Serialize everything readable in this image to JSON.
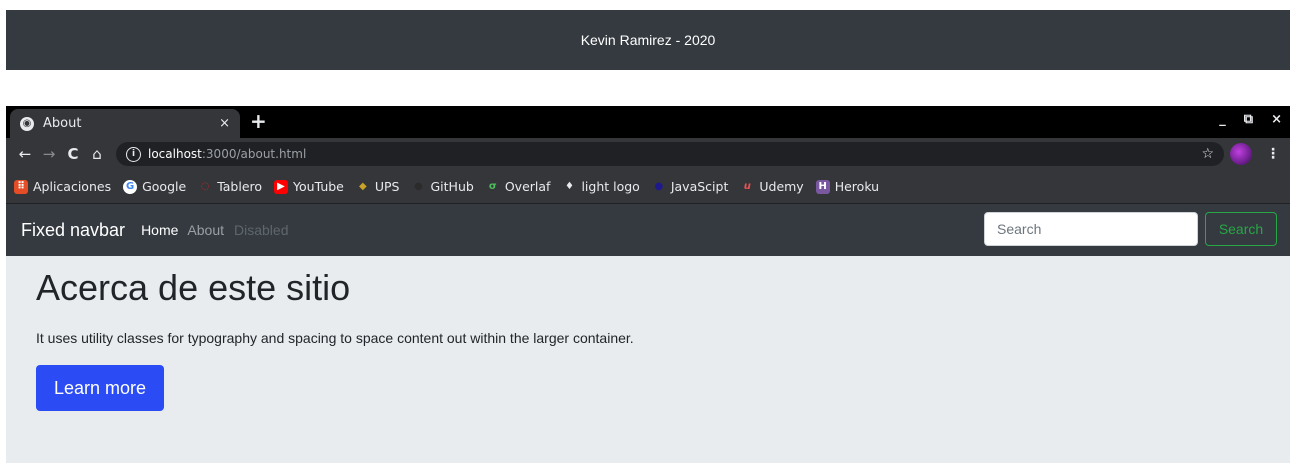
{
  "footer": {
    "text": "Kevin Ramirez - 2020"
  },
  "browser": {
    "tab": {
      "title": "About",
      "close": "×"
    },
    "new_tab": "+",
    "window_controls": [
      "_",
      "⧉",
      "×"
    ],
    "toolbar": {
      "back": "←",
      "forward": "→",
      "reload": "C",
      "home": "⌂",
      "url_host": "localhost",
      "url_path": ":3000/about.html",
      "star": "☆",
      "menu": "⋮"
    },
    "bookmarks": [
      {
        "label": "Aplicaciones",
        "icon": "apps-grid-icon",
        "color": "#e44d26",
        "glyph": "⠿"
      },
      {
        "label": "Google",
        "icon": "google-icon",
        "color": "#ffffff",
        "glyph": "G"
      },
      {
        "label": "Tablero",
        "icon": "tablero-icon",
        "color": "#e02020",
        "glyph": "◌"
      },
      {
        "label": "YouTube",
        "icon": "youtube-icon",
        "color": "#ff0000",
        "glyph": "▶"
      },
      {
        "label": "UPS",
        "icon": "ups-icon",
        "color": "#8a8f96",
        "glyph": "◆"
      },
      {
        "label": "GitHub",
        "icon": "github-icon",
        "color": "#2b2b2b",
        "glyph": "●"
      },
      {
        "label": "Overlaf",
        "icon": "overleaf-icon",
        "color": "#35363a",
        "glyph": "σ"
      },
      {
        "label": "light logo",
        "icon": "light-logo-icon",
        "color": "#35363a",
        "glyph": "♦"
      },
      {
        "label": "JavaScipt",
        "icon": "javascript-icon",
        "color": "#1e1a8c",
        "glyph": "●"
      },
      {
        "label": "Udemy",
        "icon": "udemy-icon",
        "color": "#35363a",
        "glyph": "u"
      },
      {
        "label": "Heroku",
        "icon": "heroku-icon",
        "color": "#79589f",
        "glyph": "H"
      }
    ]
  },
  "navbar": {
    "brand": "Fixed navbar",
    "links": {
      "home": "Home",
      "about": "About",
      "disabled": "Disabled"
    },
    "search_placeholder": "Search",
    "search_button": "Search"
  },
  "main": {
    "heading": "Acerca de este sitio",
    "lead": "It uses utility classes for typography and spacing to space content out within the larger container.",
    "button": "Learn more"
  }
}
